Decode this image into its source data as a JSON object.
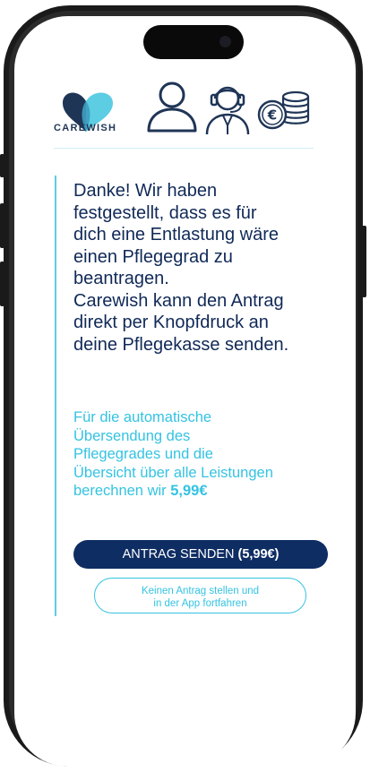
{
  "brand": {
    "name": "CAREWISH"
  },
  "header_icons": [
    "heart-logo-icon",
    "person-icon",
    "support-agent-icon",
    "coins-euro-icon"
  ],
  "message": {
    "lines": [
      "Danke! Wir haben",
      "festgestellt, dass es für",
      "dich eine Entlastung wäre",
      "einen Pflegegrad zu",
      "beantragen.",
      "Carewish kann den Antrag",
      "direkt per Knopfdruck an",
      "deine Pflegekasse senden."
    ]
  },
  "info": {
    "lines": [
      "Für die automatische",
      "Übersendung des",
      "Pflegegrades und die",
      "Übersicht über alle Leistungen"
    ],
    "last_line_prefix": "berechnen wir ",
    "price": "5,99€"
  },
  "buttons": {
    "primary_label": "ANTRAG SENDEN ",
    "primary_price": "(5,99€)",
    "secondary_line1": "Keinen Antrag stellen und",
    "secondary_line2": "in der App fortfahren"
  },
  "colors": {
    "primary_navy": "#0e2d63",
    "text_navy": "#102957",
    "accent_cyan": "#34c3e2",
    "line_cyan": "#5ccde3",
    "logo_light": "#5ccde3",
    "logo_dark": "#1f3556"
  }
}
